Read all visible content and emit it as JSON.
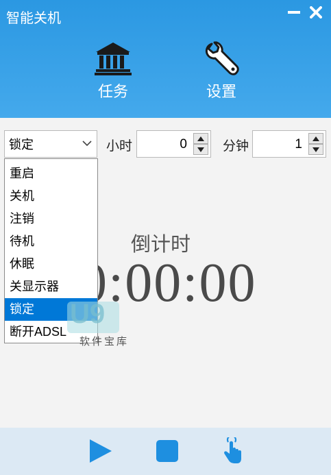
{
  "app": {
    "title": "智能关机"
  },
  "nav": {
    "task_label": "任务",
    "settings_label": "设置"
  },
  "action": {
    "selected": "锁定"
  },
  "dropdown": {
    "options": [
      "重启",
      "关机",
      "注销",
      "待机",
      "休眠",
      "关显示器",
      "锁定",
      "断开ADSL"
    ],
    "selected_index": 6
  },
  "hours": {
    "label": "小时",
    "value": "0"
  },
  "minutes": {
    "label": "分钟",
    "value": "1"
  },
  "countdown": {
    "label": "倒计时",
    "time": "0:00:00"
  },
  "watermark": {
    "logo": "U9",
    "text": "软件宝库"
  },
  "colors": {
    "header": "#2f9ce3",
    "selected_item": "#0078d7",
    "footer_icons": "#1e8fe0",
    "footer_bg": "#dce9f4"
  },
  "icons": {
    "task": "bank-icon",
    "settings": "wrench-icon",
    "start": "play-icon",
    "stop": "stop-icon",
    "manual": "touch-icon"
  }
}
